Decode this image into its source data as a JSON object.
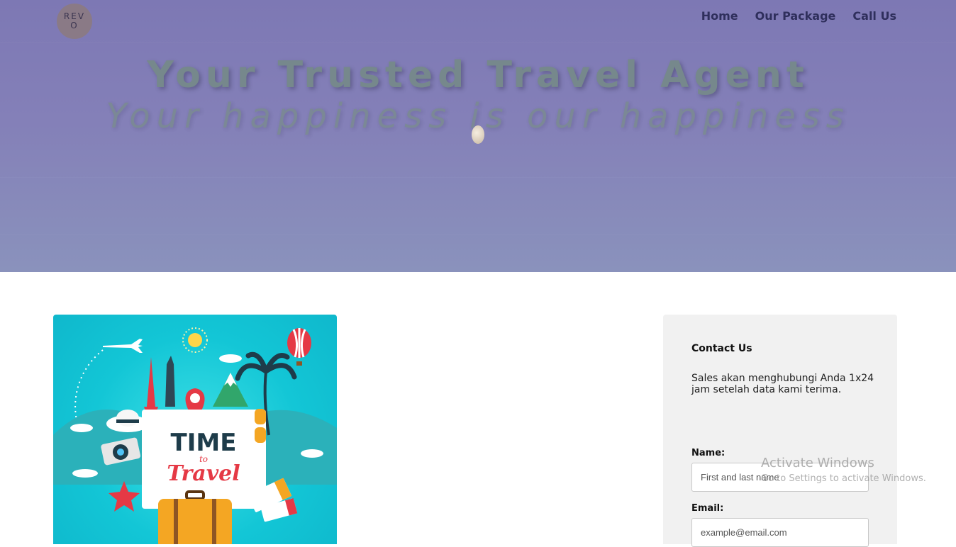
{
  "header": {
    "logo_text": "REVO",
    "nav": [
      "Home",
      "Our Package",
      "Call Us"
    ]
  },
  "hero": {
    "title": "Your Trusted Travel Agent",
    "subtitle": "Your happiness is our happiness"
  },
  "poster": {
    "line1": "TIME",
    "line2": "to",
    "line3": "Travel"
  },
  "contact": {
    "title": "Contact Us",
    "description": "Sales akan menghubungi Anda 1x24 jam setelah data kami terima.",
    "name_label": "Name:",
    "name_placeholder": "First and last name",
    "email_label": "Email:",
    "email_placeholder": "example@email.com"
  },
  "watermark": {
    "line1": "Activate Windows",
    "line2": "Go to Settings to activate Windows."
  },
  "colors": {
    "hero_bg": "#8480b8",
    "nav_text": "#2f2f5c",
    "poster_bg": "#13c6d6",
    "card_bg": "#f1f1f1"
  }
}
